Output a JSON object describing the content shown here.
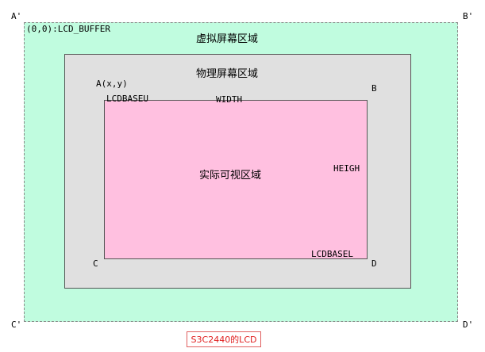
{
  "corners": {
    "a_prime": "A'",
    "b_prime": "B'",
    "c_prime": "C'",
    "d_prime": "D'",
    "a": "A(x,y)",
    "b": "B",
    "c": "C",
    "d": "D"
  },
  "labels": {
    "origin": "(0,0):LCD_BUFFER",
    "virtual_area": "虚拟屏幕区域",
    "physical_area": "物理屏幕区域",
    "visible_area": "实际可视区域",
    "lcdbaseu": "LCDBASEU",
    "width": "WIDTH",
    "heigh": "HEIGH",
    "lcdbasel": "LCDBASEL"
  },
  "caption": "S3C2440的LCD",
  "colors": {
    "virtual_area": "#c0fcdf",
    "physical_area": "#e0e0e0",
    "visible_area": "#ffc0e0",
    "caption_text": "#e02020"
  }
}
